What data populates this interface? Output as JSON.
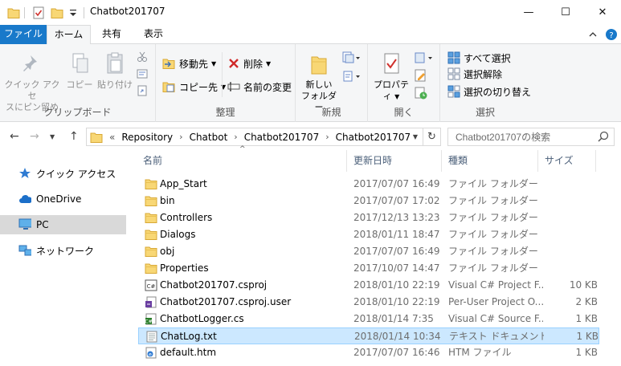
{
  "window": {
    "title": "Chatbot201707",
    "minimize": "—",
    "maximize": "☐",
    "close": "✕"
  },
  "tabs": [
    {
      "label": "ファイル"
    },
    {
      "label": "ホーム"
    },
    {
      "label": "共有"
    },
    {
      "label": "表示"
    }
  ],
  "ribbon": {
    "clipboard": {
      "label": "クリップボード",
      "pin_line1": "クイック アクセ",
      "pin_line2": "スにピン留め",
      "copy": "コピー",
      "paste": "貼り付け"
    },
    "organize": {
      "label": "整理",
      "move": "移動先",
      "copy_to": "コピー先",
      "delete": "削除",
      "rename": "名前の変更"
    },
    "new": {
      "label": "新規",
      "new_folder_line1": "新しい",
      "new_folder_line2": "フォルダー"
    },
    "open": {
      "label": "開く",
      "properties": "プロパティ"
    },
    "select": {
      "label": "選択",
      "select_all": "すべて選択",
      "select_none": "選択解除",
      "invert": "選択の切り替え"
    }
  },
  "address": {
    "overflow": "«",
    "crumbs": [
      "Repository",
      "Chatbot",
      "Chatbot201707",
      "Chatbot201707"
    ],
    "search_placeholder": "Chatbot201707の検索"
  },
  "nav": {
    "items": [
      {
        "label": "クイック アクセス",
        "icon": "star-icon"
      },
      {
        "label": "OneDrive",
        "icon": "cloud-icon"
      },
      {
        "label": "PC",
        "icon": "pc-icon"
      },
      {
        "label": "ネットワーク",
        "icon": "network-icon"
      }
    ]
  },
  "columns": {
    "name": "名前",
    "date": "更新日時",
    "type": "種類",
    "size": "サイズ"
  },
  "files": [
    {
      "name": "App_Start",
      "date": "2017/07/07 16:49",
      "type": "ファイル フォルダー",
      "size": "",
      "icon": "folder-icon"
    },
    {
      "name": "bin",
      "date": "2017/07/07 17:02",
      "type": "ファイル フォルダー",
      "size": "",
      "icon": "folder-icon"
    },
    {
      "name": "Controllers",
      "date": "2017/12/13 13:23",
      "type": "ファイル フォルダー",
      "size": "",
      "icon": "folder-icon"
    },
    {
      "name": "Dialogs",
      "date": "2018/01/11 18:47",
      "type": "ファイル フォルダー",
      "size": "",
      "icon": "folder-icon"
    },
    {
      "name": "obj",
      "date": "2017/07/07 16:49",
      "type": "ファイル フォルダー",
      "size": "",
      "icon": "folder-icon"
    },
    {
      "name": "Properties",
      "date": "2017/10/07 14:47",
      "type": "ファイル フォルダー",
      "size": "",
      "icon": "folder-icon"
    },
    {
      "name": "Chatbot201707.csproj",
      "date": "2018/01/10 22:19",
      "type": "Visual C# Project F...",
      "size": "10 KB",
      "icon": "csproj-icon"
    },
    {
      "name": "Chatbot201707.csproj.user",
      "date": "2018/01/10 22:19",
      "type": "Per-User Project O...",
      "size": "2 KB",
      "icon": "user-file-icon"
    },
    {
      "name": "ChatbotLogger.cs",
      "date": "2018/01/14 7:35",
      "type": "Visual C# Source F...",
      "size": "1 KB",
      "icon": "cs-file-icon"
    },
    {
      "name": "ChatLog.txt",
      "date": "2018/01/14 10:34",
      "type": "テキスト ドキュメント",
      "size": "1 KB",
      "icon": "text-file-icon",
      "selected": true
    },
    {
      "name": "default.htm",
      "date": "2017/07/07 16:46",
      "type": "HTM ファイル",
      "size": "1 KB",
      "icon": "htm-file-icon"
    }
  ]
}
